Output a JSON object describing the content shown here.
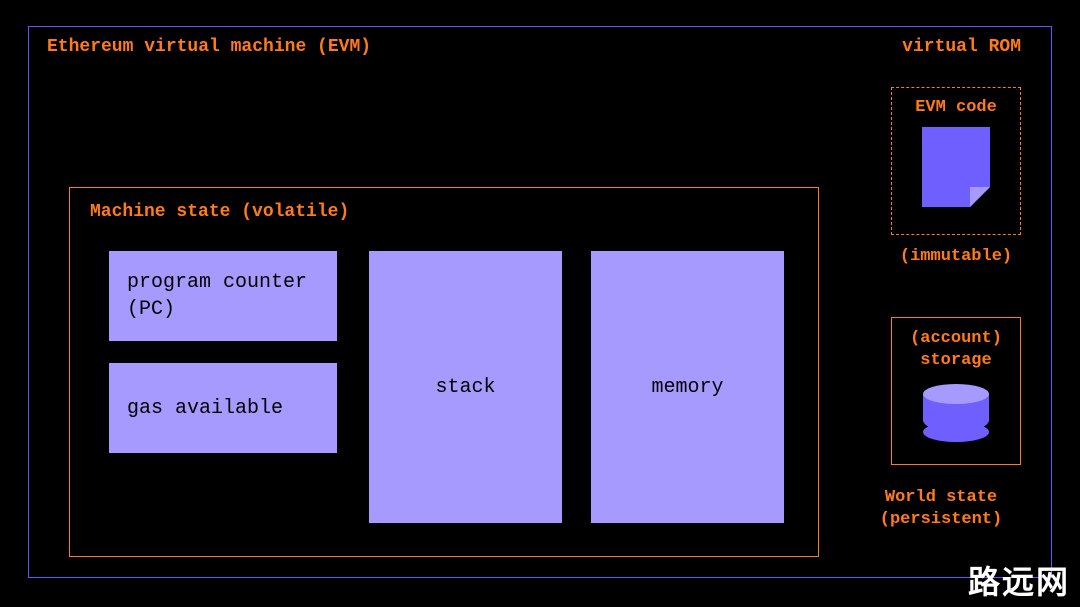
{
  "evm": {
    "title": "Ethereum virtual machine (EVM)",
    "virtual_rom_title": "virtual ROM",
    "evm_code_label": "EVM code",
    "immutable_label": "(immutable)"
  },
  "machine_state": {
    "title": "Machine state (volatile)",
    "pc_label": "program counter (PC)",
    "gas_label": "gas available",
    "stack_label": "stack",
    "memory_label": "memory"
  },
  "storage": {
    "label_line1": "(account)",
    "label_line2": "storage"
  },
  "world_state": {
    "line1": "World state",
    "line2": "(persistent)"
  },
  "watermark": "路远网"
}
